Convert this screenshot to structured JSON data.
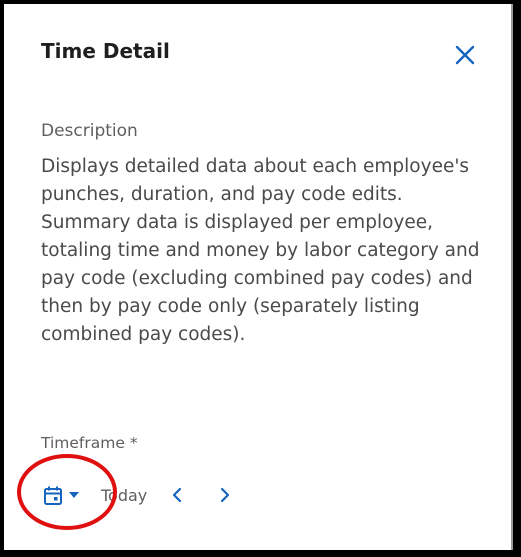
{
  "panel": {
    "title": "Time Detail",
    "close_icon": "close-icon"
  },
  "description": {
    "label": "Description",
    "text": "Displays detailed data about each employee's punches, duration, and pay code edits. Summary data is displayed per employee, totaling time and money by labor category and pay code (excluding combined pay codes) and then by pay code only (separately listing combined pay codes)."
  },
  "timeframe": {
    "label": "Timeframe *",
    "calendar_icon": "calendar-icon",
    "dropdown_icon": "caret-down-icon",
    "value": "Today",
    "prev_icon": "chevron-left-icon",
    "next_icon": "chevron-right-icon"
  },
  "colors": {
    "accent": "#1565c0",
    "annotation": "#e01010",
    "text": "#4a4a4a",
    "title": "#1f1f1f"
  }
}
